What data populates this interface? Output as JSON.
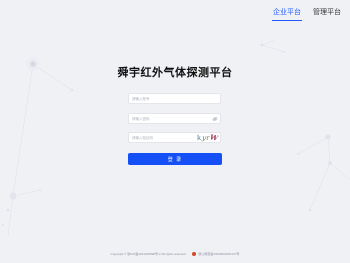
{
  "tabs": [
    {
      "label": "企业平台",
      "active": true
    },
    {
      "label": "管理平台",
      "active": false
    }
  ],
  "title": "舜宇红外气体探测平台",
  "form": {
    "account_placeholder": "请输入账号",
    "password_placeholder": "请输入密码",
    "captcha_placeholder": "请输入验证码",
    "captcha_text": [
      "k",
      "y",
      "r",
      "W"
    ],
    "login_label": "登 录"
  },
  "footer": {
    "copyright": "Copyright © 浙ICP备2021015598号-2 All rights reserved.",
    "police": "浙公网安备33028102001137号"
  },
  "colors": {
    "accent": "#1450f5",
    "background": "#f0f1f5"
  },
  "icons": {
    "password_toggle": "eye-off-icon",
    "police_badge": "police-badge-icon"
  }
}
